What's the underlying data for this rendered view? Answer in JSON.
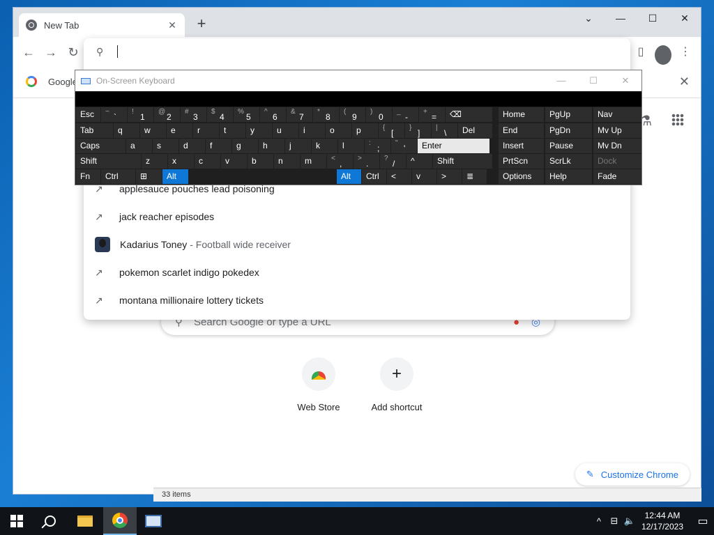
{
  "browser": {
    "tab_title": "New Tab",
    "new_tab": "+",
    "window_controls": {
      "dropdown": "⌄",
      "minimize": "—",
      "maximize": "☐",
      "close": "✕"
    },
    "bookmark_label": "Google",
    "bookmark_close": "✕"
  },
  "omnibox": {
    "value": "",
    "suggestions": [
      {
        "text": "applesauce pouches lead poisoning",
        "sub": ""
      },
      {
        "text": "jack reacher episodes",
        "sub": ""
      },
      {
        "text": "Kadarius Toney",
        "sub": "- Football wide receiver"
      },
      {
        "text": "pokemon scarlet indigo pokedex",
        "sub": ""
      },
      {
        "text": "montana millionaire lottery tickets",
        "sub": ""
      }
    ]
  },
  "ntp": {
    "search_placeholder": "Search Google or type a URL",
    "shortcuts": [
      {
        "label": "Web Store",
        "icon": "web-store-icon"
      },
      {
        "label": "Add shortcut",
        "icon": "plus-icon"
      }
    ],
    "customize_label": "Customize Chrome",
    "explorer_status": "33 items"
  },
  "osk": {
    "title": "On-Screen Keyboard",
    "row1": [
      "Esc",
      "~ `",
      "! 1",
      "@ 2",
      "# 3",
      "$ 4",
      "% 5",
      "^ 6",
      "& 7",
      "* 8",
      "( 9",
      ") 0",
      "_ -",
      "+ =",
      "⌫"
    ],
    "row2": [
      "Tab",
      "q",
      "w",
      "e",
      "r",
      "t",
      "y",
      "u",
      "i",
      "o",
      "p",
      "{ [",
      "} ]",
      "| \\",
      "Del"
    ],
    "row3": [
      "Caps",
      "a",
      "s",
      "d",
      "f",
      "g",
      "h",
      "j",
      "k",
      "l",
      ": ;",
      "\" '",
      "Enter"
    ],
    "row4": [
      "Shift",
      "z",
      "x",
      "c",
      "v",
      "b",
      "n",
      "m",
      "< ,",
      "> .",
      "? /",
      "^",
      "Shift"
    ],
    "row5": [
      "Fn",
      "Ctrl",
      "⊞",
      "Alt",
      "Alt",
      "Ctrl",
      "<",
      "v",
      ">",
      "≣"
    ],
    "side": [
      [
        "Home",
        "PgUp",
        "Nav"
      ],
      [
        "End",
        "PgDn",
        "Mv Up"
      ],
      [
        "Insert",
        "Pause",
        "Mv Dn"
      ],
      [
        "PrtScn",
        "ScrLk",
        "Dock"
      ],
      [
        "Options",
        "Help",
        "Fade"
      ]
    ]
  },
  "taskbar": {
    "time": "12:44 AM",
    "date": "12/17/2023"
  }
}
